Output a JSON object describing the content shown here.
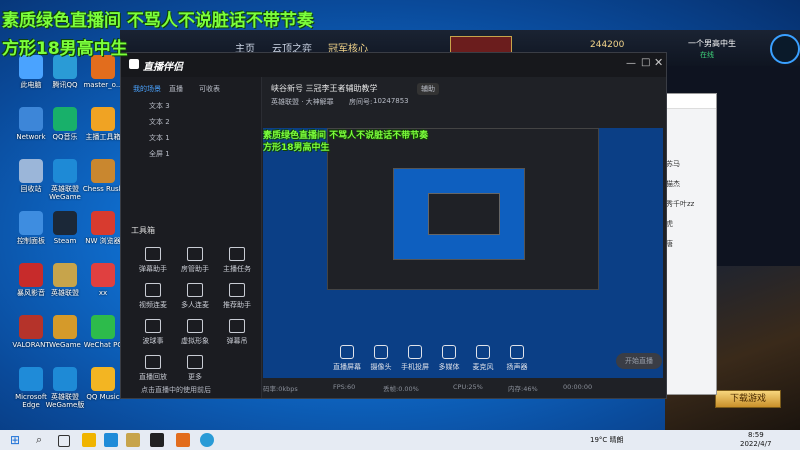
{
  "overlay": {
    "line1": "素质绿色直播间 不骂人不说脏话不带节奏",
    "line2": "方形18男高中生",
    "inner_line1": "素质绿色直播间 不骂人不说脏话不带节奏",
    "inner_line2": "方形18男高中生"
  },
  "desktop_icons": [
    {
      "label": "此电脑",
      "color": "#4aa3ff"
    },
    {
      "label": "腾讯QQ",
      "color": "#2a9bd6"
    },
    {
      "label": "master_o...",
      "color": "#e26d1d"
    },
    {
      "label": "Network",
      "color": "#3d86d8"
    },
    {
      "label": "QQ音乐",
      "color": "#18b06a"
    },
    {
      "label": "主播工具箱",
      "color": "#f0a323"
    },
    {
      "label": "回收站",
      "color": "#9bb6d9"
    },
    {
      "label": "英雄联盟WeGame",
      "color": "#1e8ad6"
    },
    {
      "label": "Chess Rush",
      "color": "#c9872f"
    },
    {
      "label": "控制面板",
      "color": "#3e8de0"
    },
    {
      "label": "Steam",
      "color": "#1b2838"
    },
    {
      "label": "NW 浏览器",
      "color": "#d83b2f"
    },
    {
      "label": "暴风影音",
      "color": "#c72b2b"
    },
    {
      "label": "英雄联盟",
      "color": "#c7a44b"
    },
    {
      "label": "xx",
      "color": "#e04040"
    },
    {
      "label": "VALORANT",
      "color": "#b5332a"
    },
    {
      "label": "WeGame",
      "color": "#d59a2a"
    },
    {
      "label": "WeChat PC",
      "color": "#2dbb4b"
    },
    {
      "label": "Microsoft Edge",
      "color": "#1f8bd8"
    },
    {
      "label": "英雄联盟WeGame版",
      "color": "#1e8ad6"
    },
    {
      "label": "QQ Music",
      "color": "#f3b522"
    }
  ],
  "game_client": {
    "tabs": [
      "主页",
      "云顶之弈",
      "冠军核心"
    ],
    "coins": "244200",
    "player_name": "一个男高中生",
    "player_status": "在线"
  },
  "app": {
    "title": "直播伴侣",
    "left_tabs": [
      "我的场景",
      "直播",
      "可收表"
    ],
    "scene_items": [
      "文本 3",
      "文本 2",
      "文本 1",
      "全屏 1"
    ],
    "room_title": "峡谷新号 三冠李王者辅助教学",
    "room_tag": "英雄联盟 · 大神解罪",
    "room_id_label": "房间号:",
    "room_id": "10247853",
    "edit_label": "辅助",
    "tools_title": "工具箱",
    "tools": [
      "弹幕助手",
      "房管助手",
      "主播任务",
      "视频连麦",
      "多人连麦",
      "推荐助手",
      "波球事",
      "虚拟形象",
      "弹幕吊",
      "直播回放",
      "更多"
    ],
    "bottom_buttons": [
      "直播屏幕",
      "摄像头",
      "手机投屏",
      "多媒体",
      "麦克风",
      "扬声器"
    ],
    "start_live": "开始直播",
    "status": {
      "bitrate": "码率:0kbps",
      "fps": "FPS:60",
      "dropped": "丢帧:0.00%",
      "cpu": "CPU:25%",
      "mem": "内存:46%",
      "time": "00:00:00"
    },
    "notice": "点击直播中的使用前后"
  },
  "right_panel": {
    "download": "下载游戏",
    "friends": [
      "苏马",
      "猫杰",
      "秀千叶zz",
      "虎",
      "唐"
    ]
  },
  "taskbar": {
    "weather": "19°C 晴朗",
    "time": "8:59",
    "date": "2022/4/7"
  }
}
